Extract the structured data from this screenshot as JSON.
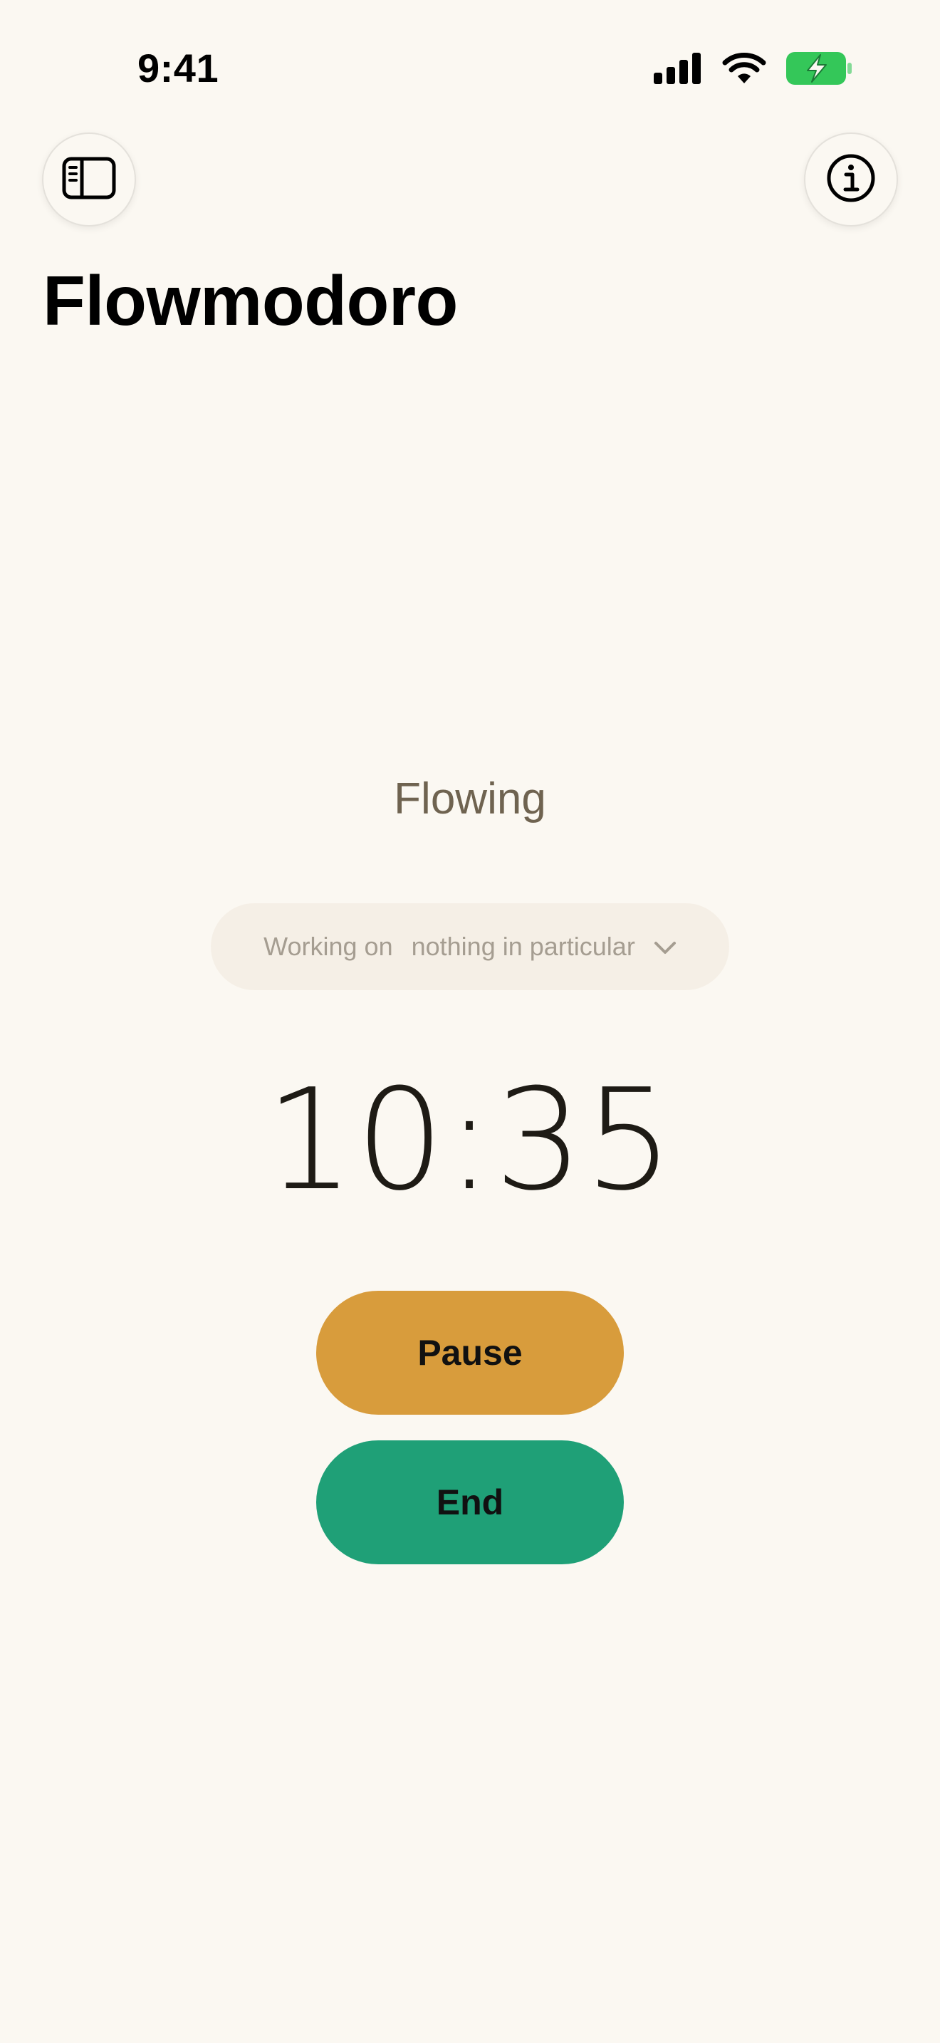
{
  "status_bar": {
    "time": "9:41",
    "icons": [
      "cellular-signal-icon",
      "wifi-icon",
      "battery-charging-icon"
    ],
    "battery_color": "#34C759"
  },
  "toolbar": {
    "left_icon": "sidebar-icon",
    "right_icon": "info-icon"
  },
  "header": {
    "title": "Flowmodoro"
  },
  "session": {
    "state": "Flowing",
    "task_prefix": "Working on",
    "task_value": "nothing in particular",
    "task_icon": "chevron-down-icon",
    "timer": "10:35"
  },
  "actions": {
    "pause_label": "Pause",
    "end_label": "End",
    "pause_color": "#D89C3C",
    "end_color": "#1FA077"
  },
  "colors": {
    "background": "#FBF8F2",
    "state_text": "#6F6350",
    "picker_background": "#F5EFE6"
  }
}
